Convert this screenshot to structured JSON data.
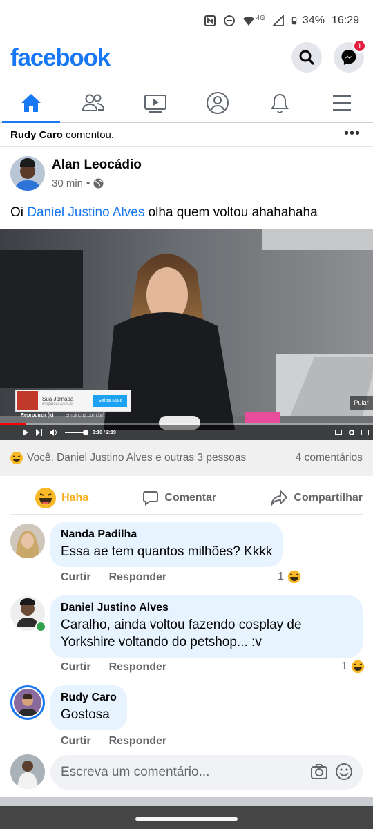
{
  "status_bar": {
    "network": "4G",
    "battery": "34%",
    "time": "16:29"
  },
  "header": {
    "logo": "facebook",
    "messenger_badge": "1"
  },
  "tabs": [
    {
      "name": "home",
      "active": true
    },
    {
      "name": "friends",
      "active": false
    },
    {
      "name": "watch",
      "active": false
    },
    {
      "name": "profile",
      "active": false
    },
    {
      "name": "notifications",
      "active": false
    },
    {
      "name": "menu",
      "active": false
    }
  ],
  "activity": {
    "actor": "Rudy Caro",
    "action": " comentou."
  },
  "post": {
    "author": "Alan Leocádio",
    "time": "30 min",
    "separator": "•",
    "text_before": "Oi ",
    "mention": "Daniel Justino Alves",
    "text_after": " olha quem voltou ahahahaha"
  },
  "video": {
    "ad_title": "Sua Jornada",
    "ad_domain": "empiricus.com.br",
    "ad_button": "Saiba Mais",
    "replay_label": "Reproduzir (k)",
    "source_domain": "empiricus.com.br/",
    "time_display": "0:10 / 2:19",
    "skip_label": "Pular",
    "progress": 0.07
  },
  "reactions": {
    "summary": "Você, Daniel Justino Alves e outras 3 pessoas",
    "comments_count": "4 comentários"
  },
  "actions": {
    "haha": "Haha",
    "comment": "Comentar",
    "share": "Compartilhar"
  },
  "comments": [
    {
      "name": "Nanda Padilha",
      "text": "Essa ae tem quantos milhões? Kkkk",
      "like": "Curtir",
      "reply": "Responder",
      "reaction_count": "1"
    },
    {
      "name": "Daniel Justino Alves",
      "text": "Caralho, ainda voltou fazendo cosplay de Yorkshire voltando do petshop... :v",
      "like": "Curtir",
      "reply": "Responder",
      "reaction_count": "1"
    },
    {
      "name": "Rudy Caro",
      "text": "Gostosa",
      "like": "Curtir",
      "reply": "Responder"
    }
  ],
  "compose": {
    "placeholder": "Escreva um comentário..."
  }
}
